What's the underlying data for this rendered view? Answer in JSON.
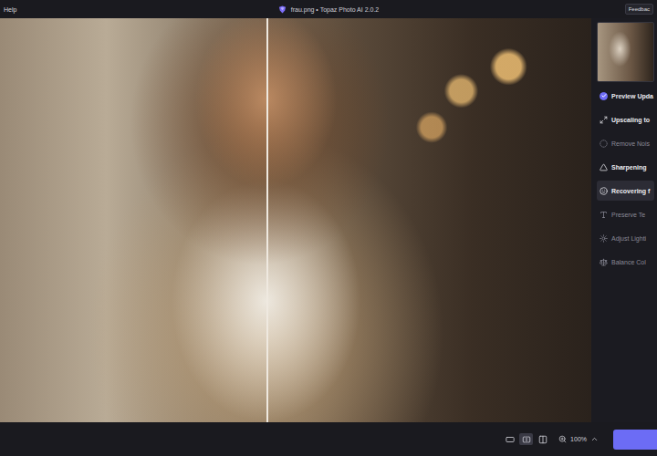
{
  "window": {
    "title": "frau.png • Topaz Photo AI 2.0.2"
  },
  "menu": [
    "Help"
  ],
  "feedback_button": "Feedbac",
  "compare": {
    "level": 0.45
  },
  "preview": {
    "label": "Preview Upda",
    "checked": true
  },
  "sidebar": {
    "items": [
      {
        "label": "Upscaling to",
        "enabled": true,
        "selected": false
      },
      {
        "label": "Remove Nois",
        "enabled": false,
        "selected": false
      },
      {
        "label": "Sharpening",
        "enabled": true,
        "selected": false
      },
      {
        "label": "Recovering f",
        "enabled": true,
        "selected": true
      },
      {
        "label": "Preserve Te",
        "enabled": false,
        "selected": false
      },
      {
        "label": "Adjust Lighti",
        "enabled": false,
        "selected": false
      },
      {
        "label": "Balance Col",
        "enabled": false,
        "selected": false
      }
    ]
  },
  "view_modes": [
    {
      "selected": false
    },
    {
      "selected": true
    },
    {
      "selected": false
    }
  ],
  "zoom": {
    "reading": "100%"
  }
}
